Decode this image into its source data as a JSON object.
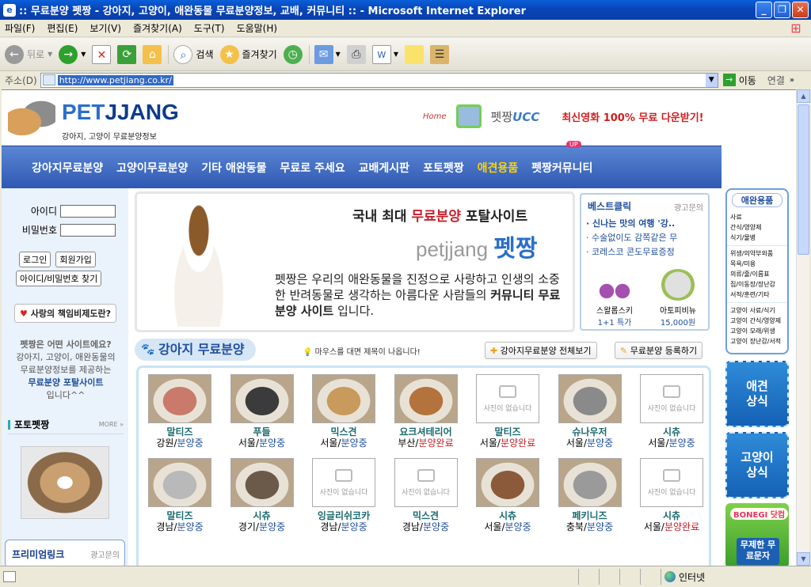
{
  "window": {
    "title": ":: 무료분양 펫짱 - 강아지, 고양이, 애완동물 무료분양정보, 교배, 커뮤니티 :: - Microsoft Internet Explorer",
    "min": "_",
    "max": "❐",
    "close": "✕"
  },
  "menu": [
    "파일(F)",
    "편집(E)",
    "보기(V)",
    "즐겨찾기(A)",
    "도구(T)",
    "도움말(H)"
  ],
  "toolbar": {
    "back": "뒤로",
    "search": "검색",
    "favorites": "즐겨찾기"
  },
  "address": {
    "label": "주소(D)",
    "url": "http://www.petjiang.co.kr/",
    "go": "이동",
    "links": "연결"
  },
  "status": {
    "zone": "인터넷"
  },
  "header": {
    "logo_word_a": "PET",
    "logo_word_b": "JJANG",
    "logo_sub": "강아지, 고양이 무료분양정보",
    "home": "Home",
    "ucc_a": "펫짱",
    "ucc_b": "UCC",
    "promo": "최신영화 100% 무료 다운받기!"
  },
  "nav": {
    "items": [
      "강아지무료분양",
      "고양이무료분양",
      "기타 애완동물",
      "무료로 주세요",
      "교배게시판",
      "포토펫짱",
      "애견용품",
      "펫짱커뮤니티"
    ],
    "badge": "UP"
  },
  "login": {
    "id_label": "아이디",
    "pw_label": "비밀번호",
    "login_btn": "로그인",
    "join_btn": "회원가입",
    "find_btn": "아이디/비밀번호 찾기"
  },
  "sidebar": {
    "responsibility": "사랑의 책임비제도란?",
    "intro_q": "펫짱은 어떤 사이트에요?",
    "intro_l1": "강아지, 고양이, 애완동물의",
    "intro_l2": "무료분양정보를 제공하는",
    "intro_b": "무료분양 포탈사이트",
    "intro_end": "입니다^^",
    "photo_title": "포토펫짱",
    "more": "MORE",
    "premium": "프리미엄링크",
    "premium_ad": "광고문의"
  },
  "banner": {
    "headline_a": "국내 최대 ",
    "headline_b": "무료분양",
    "headline_c": " 포탈사이트",
    "brand_a": "petjjang ",
    "brand_b": "펫짱",
    "desc_a": "펫짱은 우리의 애완동물을 진정으로 사랑하고 인생의 소중한 반려동물로 생각하는 아름다운 사람들의 ",
    "desc_b": "커뮤니티 무료분양 사이트",
    "desc_c": " 입니다."
  },
  "best": {
    "title": "베스트클릭",
    "ad": "광고문의",
    "items": [
      "· 신나는 맛의 여행 '강..",
      "· 수술없이도 감쪽같은 무",
      "· 코레스코 콘도무료증정"
    ],
    "prod1_name": "스왈롭스키",
    "prod1_price": "1+1 특가",
    "prod2_name": "아토피비뉴",
    "prod2_price": "15,000원"
  },
  "section": {
    "title": "강아지 무료분양",
    "hint": "마우스를 대면 제목이 나옵니다!",
    "all_btn": "강아지무료분양 전체보기",
    "reg_btn": "무료분양 등록하기",
    "no_photo": "사진이 없습니다"
  },
  "dogs": [
    {
      "breed": "말티즈",
      "region": "강원",
      "status": "분양중",
      "photo": true,
      "color": "#c97a6a"
    },
    {
      "breed": "푸들",
      "region": "서울",
      "status": "분양중",
      "photo": true,
      "color": "#3b3b3b"
    },
    {
      "breed": "믹스견",
      "region": "서울",
      "status": "분양중",
      "photo": true,
      "color": "#c89a5b"
    },
    {
      "breed": "요크셔테리어",
      "region": "부산",
      "status": "분양완료",
      "photo": true,
      "color": "#b4733c"
    },
    {
      "breed": "말티즈",
      "region": "서울",
      "status": "분양완료",
      "photo": false
    },
    {
      "breed": "슈나우저",
      "region": "서울",
      "status": "분양중",
      "photo": true,
      "color": "#8a8a8a"
    },
    {
      "breed": "시츄",
      "region": "서울",
      "status": "분양중",
      "photo": false
    },
    {
      "breed": "말티즈",
      "region": "경남",
      "status": "분양중",
      "photo": true,
      "color": "#b9b9b9"
    },
    {
      "breed": "시츄",
      "region": "경기",
      "status": "분양중",
      "photo": true,
      "color": "#6b5a4a"
    },
    {
      "breed": "잉글리쉬코카",
      "region": "경남",
      "status": "분양중",
      "photo": false
    },
    {
      "breed": "믹스견",
      "region": "경남",
      "status": "분양중",
      "photo": false
    },
    {
      "breed": "시츄",
      "region": "서울",
      "status": "분양중",
      "photo": true,
      "color": "#8b5a3a"
    },
    {
      "breed": "페키니즈",
      "region": "충북",
      "status": "분양중",
      "photo": true,
      "color": "#9a9a9a"
    },
    {
      "breed": "시츄",
      "region": "서울",
      "status": "분양완료",
      "photo": false
    }
  ],
  "right": {
    "title": "애완용품",
    "group1": [
      "사료",
      "간식/영양제",
      "식기/물병"
    ],
    "group2": [
      "위생/의약부외품",
      "목욕/미용",
      "의류/줄/이름표",
      "집/이동장/장난감",
      "서적/훈련/기타"
    ],
    "group3": [
      "고양이 사료/식기",
      "고양이 간식/영양제",
      "고양이 모래/위생",
      "고양이 장난감/서적"
    ],
    "tile1": "애견\n상식",
    "tile2": "고양이\n상식",
    "bonegi": "BONEGI 닷컴",
    "bonegi_sub": "무제한 무료문자"
  }
}
